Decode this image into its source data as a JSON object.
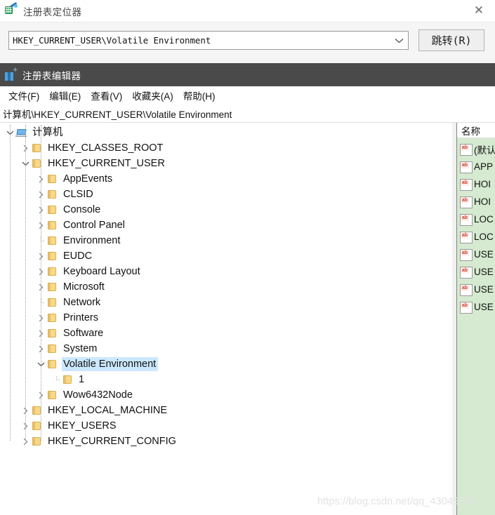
{
  "locator_window": {
    "title": "注册表定位器",
    "app_icon": "registry-locator-icon",
    "close_label": "✕",
    "path_combo": {
      "value": "HKEY_CURRENT_USER\\Volatile Environment",
      "placeholder": "HKEY_CURRENT_USER\\Volatile Environment",
      "arrow_icon": "chevron-down-icon"
    },
    "jump_button": "跳转(R)"
  },
  "regedit_window": {
    "title": "注册表编辑器",
    "app_icon": "registry-editor-icon",
    "titlebar_color": "#4a4a4a",
    "menus": [
      {
        "label": "文件(F)"
      },
      {
        "label": "编辑(E)"
      },
      {
        "label": "查看(V)"
      },
      {
        "label": "收藏夹(A)"
      },
      {
        "label": "帮助(H)"
      }
    ],
    "address_path": "计算机\\HKEY_CURRENT_USER\\Volatile Environment",
    "tree": [
      {
        "label": "计算机",
        "depth": 0,
        "icon": "computer-icon",
        "twisty": "expanded",
        "selected": false
      },
      {
        "label": "HKEY_CLASSES_ROOT",
        "depth": 1,
        "icon": "folder-icon",
        "twisty": "collapsed",
        "selected": false
      },
      {
        "label": "HKEY_CURRENT_USER",
        "depth": 1,
        "icon": "folder-icon",
        "twisty": "expanded",
        "selected": false
      },
      {
        "label": "AppEvents",
        "depth": 2,
        "icon": "folder-icon",
        "twisty": "collapsed",
        "selected": false
      },
      {
        "label": "CLSID",
        "depth": 2,
        "icon": "folder-icon",
        "twisty": "collapsed",
        "selected": false
      },
      {
        "label": "Console",
        "depth": 2,
        "icon": "folder-icon",
        "twisty": "collapsed",
        "selected": false
      },
      {
        "label": "Control Panel",
        "depth": 2,
        "icon": "folder-icon",
        "twisty": "collapsed",
        "selected": false
      },
      {
        "label": "Environment",
        "depth": 2,
        "icon": "folder-icon",
        "twisty": "none",
        "selected": false
      },
      {
        "label": "EUDC",
        "depth": 2,
        "icon": "folder-icon",
        "twisty": "collapsed",
        "selected": false
      },
      {
        "label": "Keyboard Layout",
        "depth": 2,
        "icon": "folder-icon",
        "twisty": "collapsed",
        "selected": false
      },
      {
        "label": "Microsoft",
        "depth": 2,
        "icon": "folder-icon",
        "twisty": "collapsed",
        "selected": false
      },
      {
        "label": "Network",
        "depth": 2,
        "icon": "folder-icon",
        "twisty": "none",
        "selected": false
      },
      {
        "label": "Printers",
        "depth": 2,
        "icon": "folder-icon",
        "twisty": "collapsed",
        "selected": false
      },
      {
        "label": "Software",
        "depth": 2,
        "icon": "folder-icon",
        "twisty": "collapsed",
        "selected": false
      },
      {
        "label": "System",
        "depth": 2,
        "icon": "folder-icon",
        "twisty": "collapsed",
        "selected": false
      },
      {
        "label": "Volatile Environment",
        "depth": 2,
        "icon": "folder-icon",
        "twisty": "expanded",
        "selected": true
      },
      {
        "label": "1",
        "depth": 3,
        "icon": "folder-icon",
        "twisty": "none",
        "selected": false
      },
      {
        "label": "Wow6432Node",
        "depth": 2,
        "icon": "folder-icon",
        "twisty": "collapsed",
        "selected": false
      },
      {
        "label": "HKEY_LOCAL_MACHINE",
        "depth": 1,
        "icon": "folder-icon",
        "twisty": "collapsed",
        "selected": false
      },
      {
        "label": "HKEY_USERS",
        "depth": 1,
        "icon": "folder-icon",
        "twisty": "collapsed",
        "selected": false
      },
      {
        "label": "HKEY_CURRENT_CONFIG",
        "depth": 1,
        "icon": "folder-icon",
        "twisty": "collapsed",
        "selected": false
      }
    ],
    "values_pane": {
      "background_color": "#d5ead0",
      "column_header": "名称",
      "rows": [
        {
          "icon": "string-value-icon",
          "name": "(默认"
        },
        {
          "icon": "string-value-icon",
          "name": "APP"
        },
        {
          "icon": "string-value-icon",
          "name": "HOI"
        },
        {
          "icon": "string-value-icon",
          "name": "HOI"
        },
        {
          "icon": "string-value-icon",
          "name": "LOC"
        },
        {
          "icon": "string-value-icon",
          "name": "LOC"
        },
        {
          "icon": "string-value-icon",
          "name": "USE"
        },
        {
          "icon": "string-value-icon",
          "name": "USE"
        },
        {
          "icon": "string-value-icon",
          "name": "USE"
        },
        {
          "icon": "string-value-icon",
          "name": "USE"
        }
      ]
    }
  },
  "watermark": {
    "text": "https://blog.csdn.net/qq_43045569"
  }
}
